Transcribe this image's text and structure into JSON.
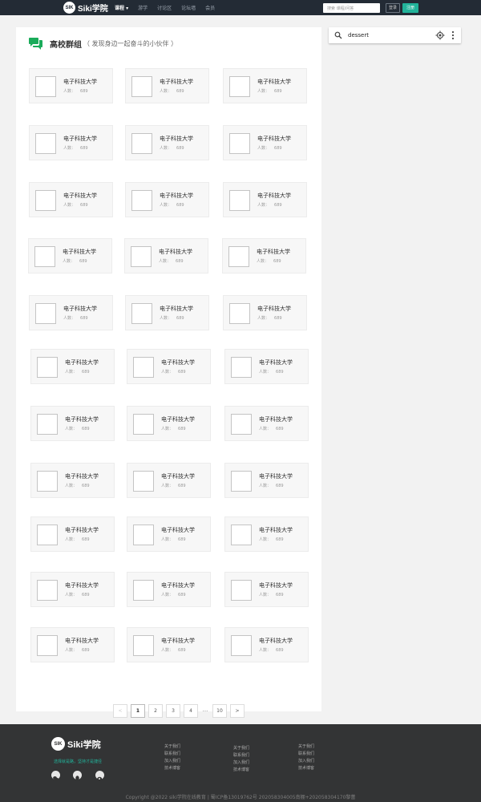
{
  "nav": {
    "logo_mark": "SIK",
    "logo_text": "Siki学院",
    "items": [
      "课程 ▾",
      "游学",
      "讨论区",
      "论坛墙",
      "会员"
    ],
    "search_placeholder": "搜索 课程/问答",
    "login_label": "登录",
    "register_label": "注册"
  },
  "section": {
    "title": "高校群组",
    "subtitle": "（ 发现身边一起奋斗的小伙伴 ）"
  },
  "groups": [
    {
      "name": "电子科技大学",
      "count_label": "人数：",
      "count": "689"
    },
    {
      "name": "电子科技大学",
      "count_label": "人数：",
      "count": "689"
    },
    {
      "name": "电子科技大学",
      "count_label": "人数：",
      "count": "689"
    },
    {
      "name": "电子科技大学",
      "count_label": "人数：",
      "count": "689"
    },
    {
      "name": "电子科技大学",
      "count_label": "人数：",
      "count": "689"
    },
    {
      "name": "电子科技大学",
      "count_label": "人数：",
      "count": "689"
    },
    {
      "name": "电子科技大学",
      "count_label": "人数：",
      "count": "689"
    },
    {
      "name": "电子科技大学",
      "count_label": "人数：",
      "count": "689"
    },
    {
      "name": "电子科技大学",
      "count_label": "人数：",
      "count": "689"
    },
    {
      "name": "电子科技大学",
      "count_label": "人数：",
      "count": "689"
    },
    {
      "name": "电子科技大学",
      "count_label": "人数：",
      "count": "689"
    },
    {
      "name": "电子科技大学",
      "count_label": "人数：",
      "count": "689"
    },
    {
      "name": "电子科技大学",
      "count_label": "人数：",
      "count": "689"
    },
    {
      "name": "电子科技大学",
      "count_label": "人数：",
      "count": "689"
    },
    {
      "name": "电子科技大学",
      "count_label": "人数：",
      "count": "689"
    },
    {
      "name": "电子科技大学",
      "count_label": "人数：",
      "count": "689"
    },
    {
      "name": "电子科技大学",
      "count_label": "人数：",
      "count": "689"
    },
    {
      "name": "电子科技大学",
      "count_label": "人数：",
      "count": "689"
    },
    {
      "name": "电子科技大学",
      "count_label": "人数：",
      "count": "689"
    },
    {
      "name": "电子科技大学",
      "count_label": "人数：",
      "count": "689"
    },
    {
      "name": "电子科技大学",
      "count_label": "人数：",
      "count": "689"
    },
    {
      "name": "电子科技大学",
      "count_label": "人数：",
      "count": "689"
    },
    {
      "name": "电子科技大学",
      "count_label": "人数：",
      "count": "689"
    },
    {
      "name": "电子科技大学",
      "count_label": "人数：",
      "count": "689"
    },
    {
      "name": "电子科技大学",
      "count_label": "人数：",
      "count": "689"
    },
    {
      "name": "电子科技大学",
      "count_label": "人数：",
      "count": "689"
    },
    {
      "name": "电子科技大学",
      "count_label": "人数：",
      "count": "689"
    },
    {
      "name": "电子科技大学",
      "count_label": "人数：",
      "count": "689"
    },
    {
      "name": "电子科技大学",
      "count_label": "人数：",
      "count": "689"
    },
    {
      "name": "电子科技大学",
      "count_label": "人数：",
      "count": "689"
    },
    {
      "name": "电子科技大学",
      "count_label": "人数：",
      "count": "689"
    },
    {
      "name": "电子科技大学",
      "count_label": "人数：",
      "count": "689"
    },
    {
      "name": "电子科技大学",
      "count_label": "人数：",
      "count": "689"
    }
  ],
  "pagination": {
    "prev": "<",
    "pages": [
      "1",
      "2",
      "3",
      "4"
    ],
    "ellipsis": "···",
    "last": "10",
    "next": ">",
    "current": "1"
  },
  "map_search": {
    "query": "dessert",
    "icons": [
      "search-icon",
      "my-location-icon",
      "more-vert-icon"
    ]
  },
  "footer": {
    "logo_mark": "SIK",
    "logo_text": "Siki学院",
    "slogan": "选择就是路，坚持才是捷径",
    "col1": [
      "关于我们",
      "联系我们",
      "加入我们",
      "技术博客"
    ],
    "col2": [
      "关于我们",
      "联系我们",
      "加入我们",
      "技术博客"
    ],
    "col3": [
      "关于我们",
      "联系我们",
      "加入我们",
      "技术博客"
    ],
    "copyright": "Copyright @2022 siki学院在线教育 | 蜀ICP备13019762号 202058304005南棚+202058304170黎蕾",
    "social_icons": [
      "wechat-icon",
      "qq-icon",
      "weibo-icon"
    ]
  },
  "colors": {
    "accent": "#22b39a",
    "topbar": "#232b35",
    "footer": "#333435"
  }
}
